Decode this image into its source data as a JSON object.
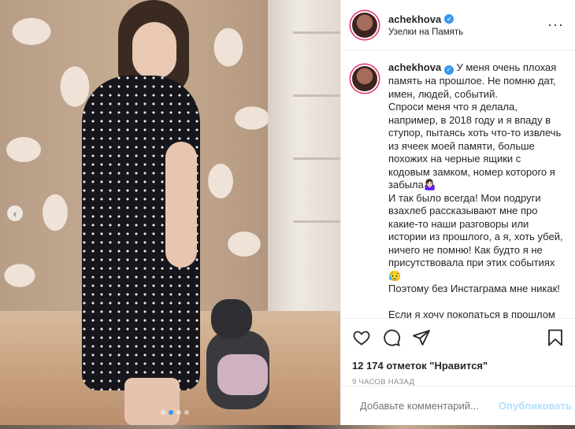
{
  "post": {
    "username": "achekhova",
    "location": "Узелки на Память",
    "caption_username": "achekhova",
    "caption_text": "У меня очень плохая память на прошлое. Не помню дат, имен, людей, событий.\nСпроси меня что я делала, например, в 2018 году и я впаду в ступор, пытаясь хоть что-то извлечь из ячеек моей памяти, больше похожих на черные ящики с кодовым замком, номер которого я забыла🤷🏻‍♀️\nИ так было всегда! Мои подруги взахлеб рассказывают мне про какие-то наши разговоры или истории из прошлого, а я, хоть убей, ничего не помню! Как будто я не присутствовала при этих событиях 😥\nПоэтому без Инстаграма мне никак!\n\nЕсли я хочу покопаться в прошлом",
    "likes": "12 174 отметок \"Нравится\"",
    "time": "9 ЧАСОВ НАЗАД",
    "comment_placeholder": "Добавьте комментарий...",
    "post_button": "Опубликовать",
    "verified_mark": "✓",
    "more_label": "···",
    "prev_label": "‹"
  },
  "carousel": {
    "total": 4,
    "active": 2
  },
  "colors": {
    "accent": "#3897f0",
    "post_button_disabled": "#b2dffc",
    "muted": "#8e8e8e"
  },
  "icons": [
    "heart-icon",
    "comment-icon",
    "share-icon",
    "bookmark-icon",
    "emoji-icon",
    "more-icon",
    "verified-icon"
  ]
}
